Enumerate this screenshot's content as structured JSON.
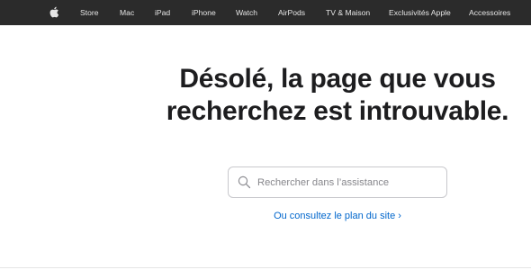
{
  "nav": {
    "apple_logo": "apple-icon",
    "items": [
      "Store",
      "Mac",
      "iPad",
      "iPhone",
      "Watch",
      "AirPods",
      "TV & Maison",
      "Exclusivités Apple",
      "Accessoires"
    ]
  },
  "main": {
    "title_line1": "Désolé, la page que vous",
    "title_line2": "recherchez est introuvable.",
    "search": {
      "placeholder": "Rechercher dans l’assistance",
      "value": "",
      "icon": "search-icon"
    },
    "sitemap_link": "Ou consultez le plan du site ›"
  },
  "colors": {
    "nav_background": "#2b2b2b",
    "link": "#0066cc",
    "title": "#1d1d1f"
  }
}
